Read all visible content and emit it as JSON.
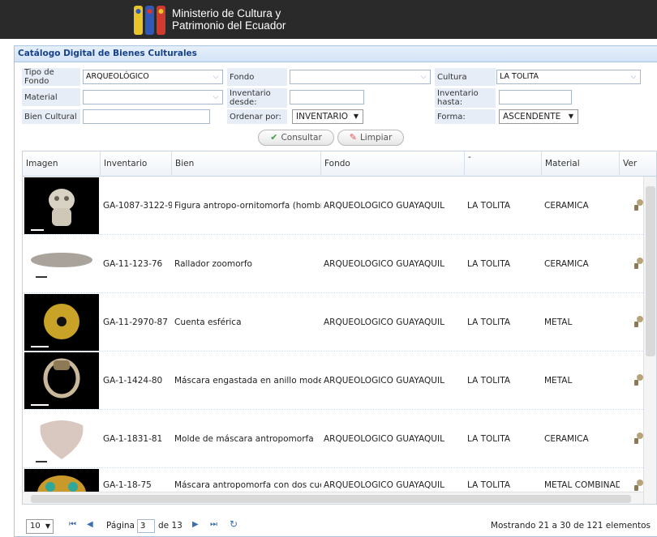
{
  "header": {
    "ministry_line1": "Ministerio de Cultura y",
    "ministry_line2": "Patrimonio  del Ecuador"
  },
  "panel": {
    "title": "Catálogo Digital de Bienes Culturales"
  },
  "form": {
    "tipo_fondo_label": "Tipo de Fondo",
    "tipo_fondo_value": "ARQUEOLÓGICO",
    "fondo_label": "Fondo",
    "fondo_value": "",
    "cultura_label": "Cultura",
    "cultura_value": "LA TOLITA",
    "material_label": "Material",
    "material_value": "",
    "inventario_desde_label": "Inventario desde:",
    "inventario_desde_value": "",
    "inventario_hasta_label": "Inventario hasta:",
    "inventario_hasta_value": "",
    "bien_cultural_label": "Bien Cultural",
    "bien_cultural_value": "",
    "ordenar_label": "Ordenar por:",
    "ordenar_value": "INVENTARIO",
    "forma_label": "Forma:",
    "forma_value": "ASCENDENTE",
    "consultar_label": "Consultar",
    "limpiar_label": "Limpiar"
  },
  "table": {
    "columns": [
      "Imagen",
      "Inventario",
      "Bien",
      "Fondo",
      "-",
      "Material",
      "Ver"
    ],
    "rows": [
      {
        "inventario": "GA-1087-3122-9",
        "bien": "Figura antropo-ornitomorfa (hombr",
        "fondo": "ARQUEOLOGICO GUAYAQUIL",
        "cultura": "LA TOLITA",
        "material": "CERAMICA"
      },
      {
        "inventario": "GA-11-123-76",
        "bien": "Rallador zoomorfo",
        "fondo": "ARQUEOLOGICO GUAYAQUIL",
        "cultura": "LA TOLITA",
        "material": "CERAMICA"
      },
      {
        "inventario": "GA-11-2970-87",
        "bien": "Cuenta esférica",
        "fondo": "ARQUEOLOGICO GUAYAQUIL",
        "cultura": "LA TOLITA",
        "material": "METAL"
      },
      {
        "inventario": "GA-1-1424-80",
        "bien": "Máscara engastada en anillo moder",
        "fondo": "ARQUEOLOGICO GUAYAQUIL",
        "cultura": "LA TOLITA",
        "material": "METAL"
      },
      {
        "inventario": "GA-1-1831-81",
        "bien": "Molde de máscara antropomorfa",
        "fondo": "ARQUEOLOGICO GUAYAQUIL",
        "cultura": "LA TOLITA",
        "material": "CERAMICA"
      },
      {
        "inventario": "GA-1-18-75",
        "bien": "Máscara antropomorfa con dos cue",
        "fondo": "ARQUEOLOGICO GUAYAQUIL",
        "cultura": "LA TOLITA",
        "material": "METAL COMBINAD"
      }
    ]
  },
  "pager": {
    "page_size": "10",
    "page_label": "Página",
    "page_value": "3",
    "of_label": "de 13",
    "status": "Mostrando 21 a 30 de 121 elementos"
  }
}
